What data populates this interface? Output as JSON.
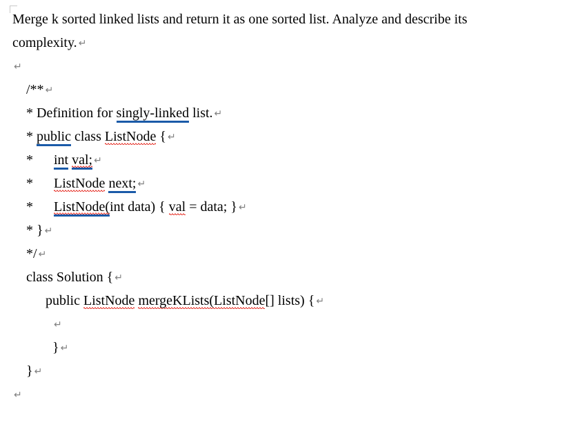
{
  "problem": {
    "statement_line1": "Merge k sorted linked lists and return it as one sorted list. Analyze and describe its",
    "statement_line2": "complexity."
  },
  "code": {
    "c1": "/**",
    "c2_prefix": " * Definition for ",
    "c2_singly_linked": "singly-linked",
    "c2_suffix": " list.",
    "c3_star": " * ",
    "c3_public": "public",
    "c3_class": " class ",
    "c3_listnode": "ListNode",
    "c3_brace": " {",
    "c4_star": " *     ",
    "c4_int": "int",
    "c4_space": " ",
    "c4_val": "val;",
    "c5_star": " *     ",
    "c5_listnode": "ListNode",
    "c5_space": " ",
    "c5_next": "next;",
    "c6_star": " *     ",
    "c6_listnode_ctor": "ListNode(",
    "c6_mid": "int data) { ",
    "c6_val": "val",
    "c6_end": " = data; }",
    "c7": " * }",
    "c8": " */",
    "c9": "class Solution {",
    "c10_prefix": "public ",
    "c10_listnode": "ListNode",
    "c10_space": " ",
    "c10_method": "mergeKLists(ListNode",
    "c10_suffix": "[] lists) {",
    "c11": "    ",
    "c12": "}",
    "c13": "}"
  },
  "glyph": {
    "pmark": "↵"
  }
}
